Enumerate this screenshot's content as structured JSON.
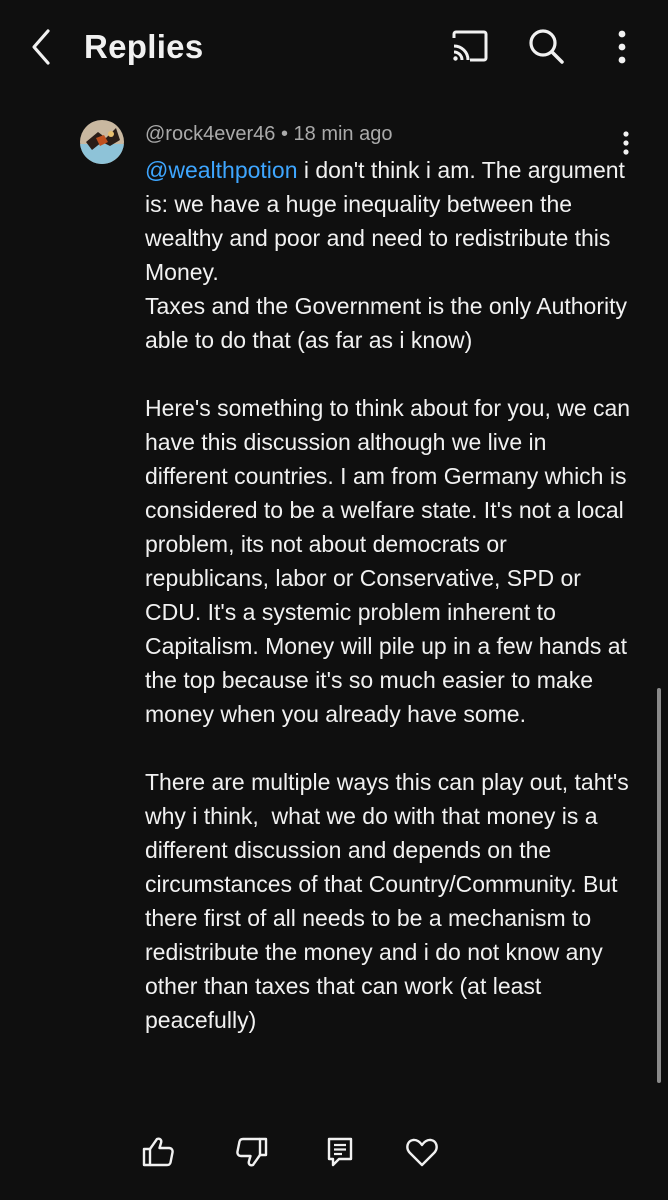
{
  "header": {
    "title": "Replies",
    "back_icon": "chevron-left-icon",
    "cast_icon": "cast-icon",
    "search_icon": "search-icon",
    "more_icon": "more-vertical-icon"
  },
  "comment": {
    "author": "@rock4ever46",
    "separator": "•",
    "time": "18 min ago",
    "mention": "@wealthpotion",
    "paragraphs": [
      " i don't think i am. The argument is: we have a huge inequality between the wealthy and poor and need to redistribute this Money.\nTaxes and the Government is the only Authority able to do that (as far as i know)",
      "Here's something to think about for you, we can have this discussion although we live in different countries. I am from Germany which is considered to be a welfare state. It's not a local problem, its not about democrats or republicans, labor or Conservative, SPD or CDU. It's a systemic problem inherent to Capitalism. Money will pile up in a few hands at the top because it's so much easier to make money when you already have some.",
      "There are multiple ways this can play out, taht's why i think,  what we do with that money is a different discussion and depends on the circumstances of that Country/Community. But there first of all needs to be a mechanism to redistribute the money and i do not know any other than taxes that can work (at least peacefully)"
    ]
  },
  "actions": {
    "like_icon": "thumbs-up-icon",
    "dislike_icon": "thumbs-down-icon",
    "reply_icon": "reply-comment-icon",
    "heart_icon": "heart-icon"
  },
  "colors": {
    "background": "#0f0f0f",
    "text": "#f1f1f1",
    "meta": "#aaaaaa",
    "mention": "#3ea6ff"
  }
}
